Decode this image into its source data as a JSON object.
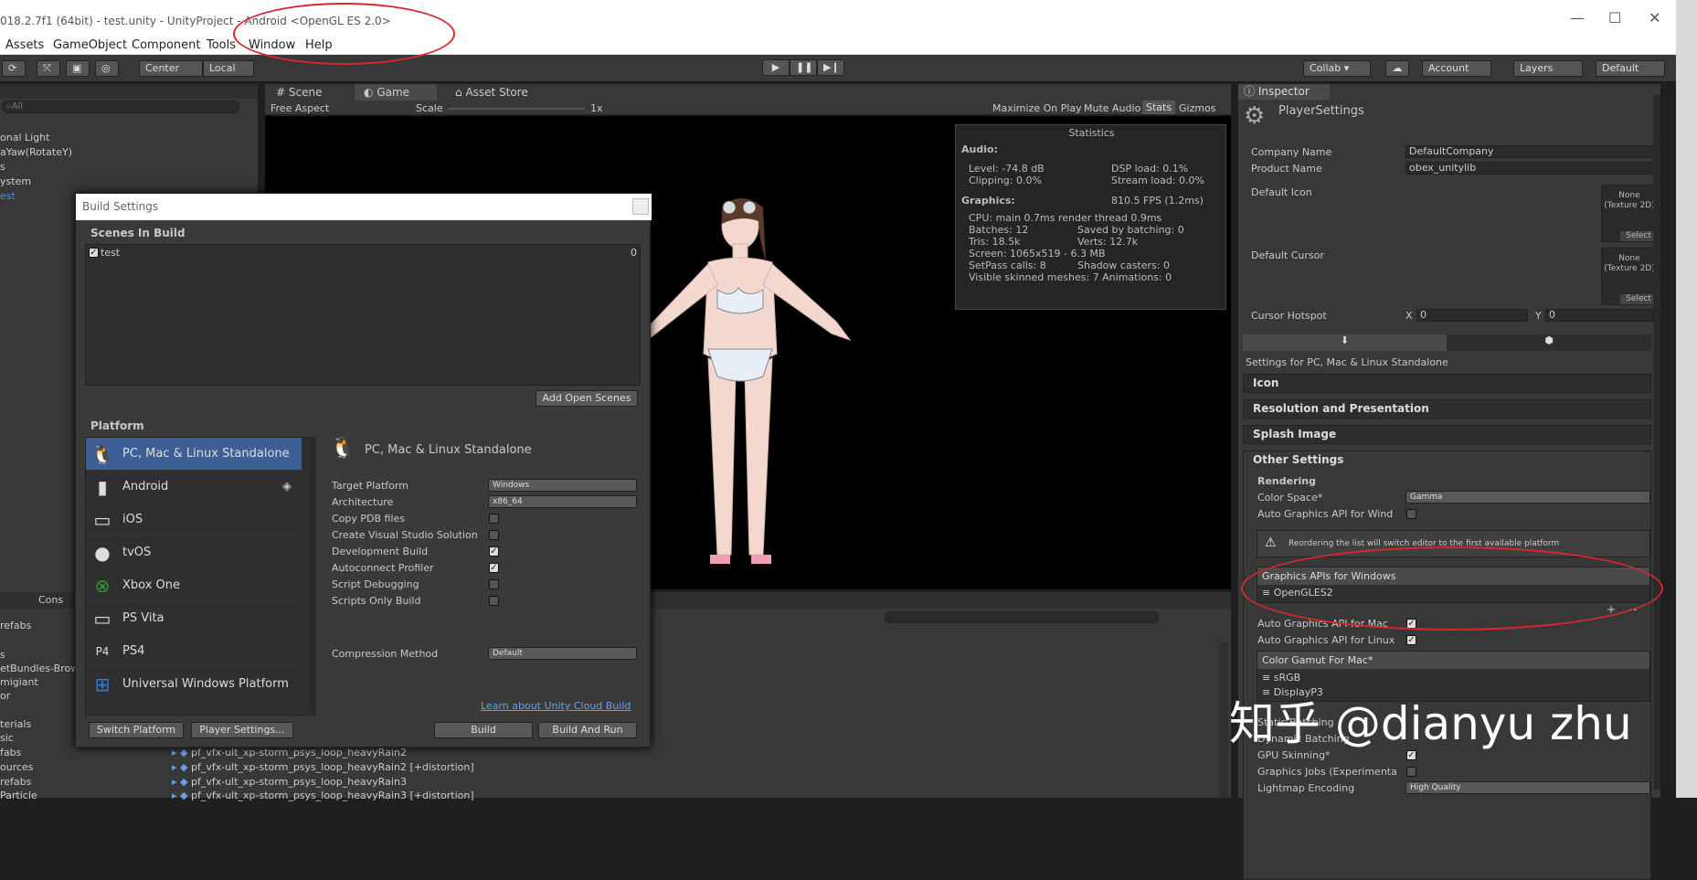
{
  "window": {
    "title": "018.2.7f1 (64bit) - test.unity - UnityProject - Android <OpenGL ES 2.0>",
    "controls": [
      "—",
      "☐",
      "✕"
    ]
  },
  "menu": [
    "Assets",
    "GameObject",
    "Component",
    "Tools",
    "Window",
    "Help"
  ],
  "toolbar": {
    "pivot": "Center",
    "space": "Local",
    "collab": "Collab ▾",
    "account": "Account",
    "layers": "Layers",
    "layout": "Default"
  },
  "hierarchy": {
    "search": "All",
    "items": [
      "onal Light",
      "aYaw(RotateY)",
      "s",
      "ystem",
      "est"
    ]
  },
  "game_tabs": {
    "scene": "Scene",
    "game": "Game",
    "asset_store": "Asset Store",
    "aspect": "Free Aspect",
    "scale_label": "Scale",
    "scale_value": "1x",
    "maximize": "Maximize On Play",
    "mute": "Mute Audio",
    "stats": "Stats",
    "gizmos": "Gizmos"
  },
  "stats": {
    "title": "Statistics",
    "audio_hdr": "Audio:",
    "level": "Level: -74.8 dB",
    "clipping": "Clipping: 0.0%",
    "dsp": "DSP load: 0.1%",
    "stream": "Stream load: 0.0%",
    "graphics_hdr": "Graphics:",
    "fps": "810.5 FPS (1.2ms)",
    "cpu": "CPU: main 0.7ms  render thread 0.9ms",
    "batches": "Batches: 12",
    "saved": "Saved by batching: 0",
    "tris": "Tris: 18.5k",
    "verts": "Verts: 12.7k",
    "screen": "Screen: 1065x519 - 6.3 MB",
    "setpass": "SetPass calls: 8",
    "shadow": "Shadow casters: 0",
    "skinned": "Visible skinned meshes: 7  Animations: 0"
  },
  "build": {
    "title": "Build Settings",
    "scenes_hdr": "Scenes In Build",
    "scene_name": "test",
    "scene_index": "0",
    "add_open": "Add Open Scenes",
    "platform_hdr": "Platform",
    "platforms": [
      {
        "name": "PC, Mac & Linux Standalone",
        "icon": "penguin-icon"
      },
      {
        "name": "Android",
        "icon": "android-icon"
      },
      {
        "name": "iOS",
        "icon": "ios-icon"
      },
      {
        "name": "tvOS",
        "icon": "tvos-icon"
      },
      {
        "name": "Xbox One",
        "icon": "xbox-icon"
      },
      {
        "name": "PS Vita",
        "icon": "psvita-icon"
      },
      {
        "name": "PS4",
        "icon": "ps4-icon"
      },
      {
        "name": "Universal Windows Platform",
        "icon": "windows-icon"
      }
    ],
    "sel_platform": "PC, Mac & Linux Standalone",
    "target_platform_label": "Target Platform",
    "target_platform": "Windows",
    "arch_label": "Architecture",
    "arch": "x86_64",
    "copy_pdb": "Copy PDB files",
    "create_vs": "Create Visual Studio Solution",
    "dev_build": "Development Build",
    "autoconnect": "Autoconnect Profiler",
    "script_debug": "Script Debugging",
    "scripts_only": "Scripts Only Build",
    "compression_label": "Compression Method",
    "compression": "Default",
    "learn": "Learn about Unity Cloud Build",
    "switch": "Switch Platform",
    "player_settings": "Player Settings...",
    "build_btn": "Build",
    "build_run": "Build And Run"
  },
  "bottom": {
    "console_tab": "Cons",
    "left_items": [
      "refabs",
      "s",
      "etBundles-Brow",
      "migiant",
      "or",
      "terials",
      "sic",
      "fabs",
      "ources",
      "refabs",
      "Particle"
    ],
    "files": [
      "pf_vfx-ult_xp-storm_psys_loop_heavyRain2",
      "pf_vfx-ult_xp-storm_psys_loop_heavyRain2 [+distortion]",
      "pf_vfx-ult_xp-storm_psys_loop_heavyRain3",
      "pf_vfx-ult_xp-storm_psys_loop_heavyRain3 [+distortion]"
    ]
  },
  "inspector": {
    "tab": "Inspector",
    "title": "PlayerSettings",
    "company_label": "Company Name",
    "company": "DefaultCompany",
    "product_label": "Product Name",
    "product": "obex_unitylib",
    "default_icon": "Default Icon",
    "default_cursor": "Default Cursor",
    "tex_none": "None",
    "tex_type": "(Texture 2D)",
    "select": "Select",
    "hotspot": "Cursor Hotspot",
    "x": "X",
    "x_val": "0",
    "y": "Y",
    "y_val": "0",
    "settings_for": "Settings for PC, Mac & Linux Standalone",
    "icon_sect": "Icon",
    "res_sect": "Resolution and Presentation",
    "splash_sect": "Splash Image",
    "other_sect": "Other Settings",
    "rendering": "Rendering",
    "color_space_label": "Color Space*",
    "color_space": "Gamma",
    "auto_win": "Auto Graphics API  for Wind",
    "warning": "Reordering the list will switch editor to the first available platform",
    "apis_hdr": "Graphics APIs for Windows",
    "api_item": "OpenGLES2",
    "auto_mac": "Auto Graphics API  for Mac",
    "auto_linux": "Auto Graphics API  for Linux",
    "gamut_hdr": "Color Gamut For Mac*",
    "gamut_items": [
      "sRGB",
      "DisplayP3"
    ],
    "static_batching": "Static Batching",
    "dynamic_batching": "Dynamic Batching",
    "gpu_skinning": "GPU Skinning*",
    "graphics_jobs": "Graphics Jobs (Experimenta",
    "lightmap_label": "Lightmap Encoding",
    "lightmap": "High Quality"
  },
  "watermark": "知乎 @dianyu zhu"
}
